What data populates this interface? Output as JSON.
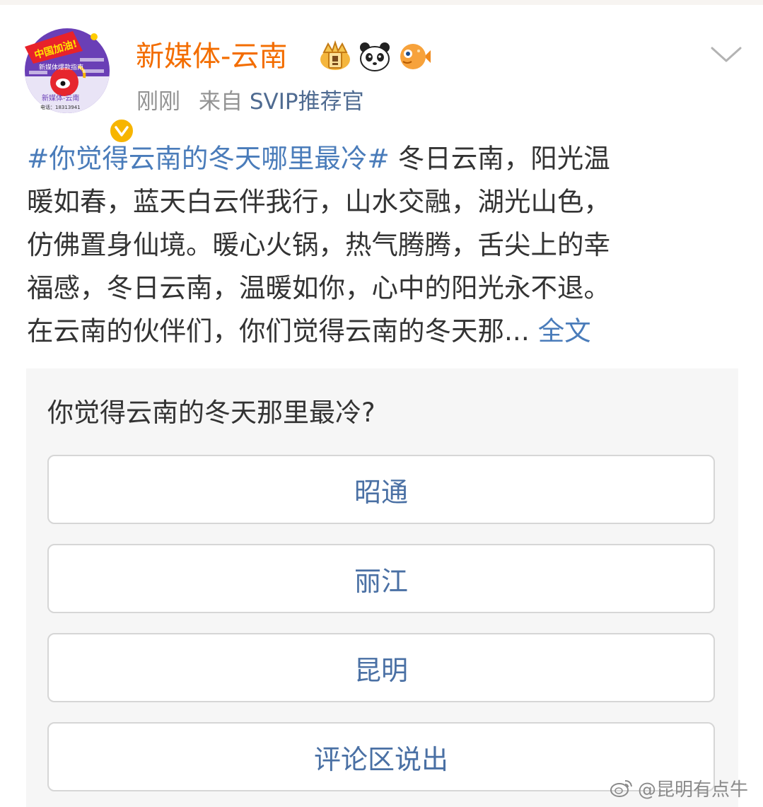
{
  "post": {
    "username": "新媒体-云南",
    "time": "刚刚",
    "from_prefix": "来自",
    "source": "SVIP推荐官",
    "badges": [
      "crown-badge-icon",
      "panda-badge-icon",
      "fish-badge-icon"
    ],
    "avatar_text": {
      "banner": "中国加油!",
      "line1": "新媒体爆款指南",
      "bottom": "新媒体-云南",
      "phone": "电话：18313941"
    },
    "text": {
      "hashtag": "#你觉得云南的冬天哪里最冷#",
      "line1_rest": " 冬日云南，阳光温",
      "line2": "暖如春，蓝天白云伴我行，山水交融，湖光山色，",
      "line3": "仿佛置身仙境。暖心火锅，热气腾腾，舌尖上的幸",
      "line4": "福感，冬日云南，温暖如你，心中的阳光永不退。",
      "line5": "在云南的伙伴们，你们觉得云南的冬天那... ",
      "full_text_link": "全文"
    }
  },
  "poll": {
    "question": "你觉得云南的冬天那里最冷?",
    "options": [
      "昭通",
      "丽江",
      "昆明",
      "评论区说出"
    ]
  },
  "watermark": "@昆明有点牛",
  "colors": {
    "username": "#f36d00",
    "link": "#4a7cba",
    "option_text": "#4a70a4",
    "verified": "#f7b500"
  }
}
